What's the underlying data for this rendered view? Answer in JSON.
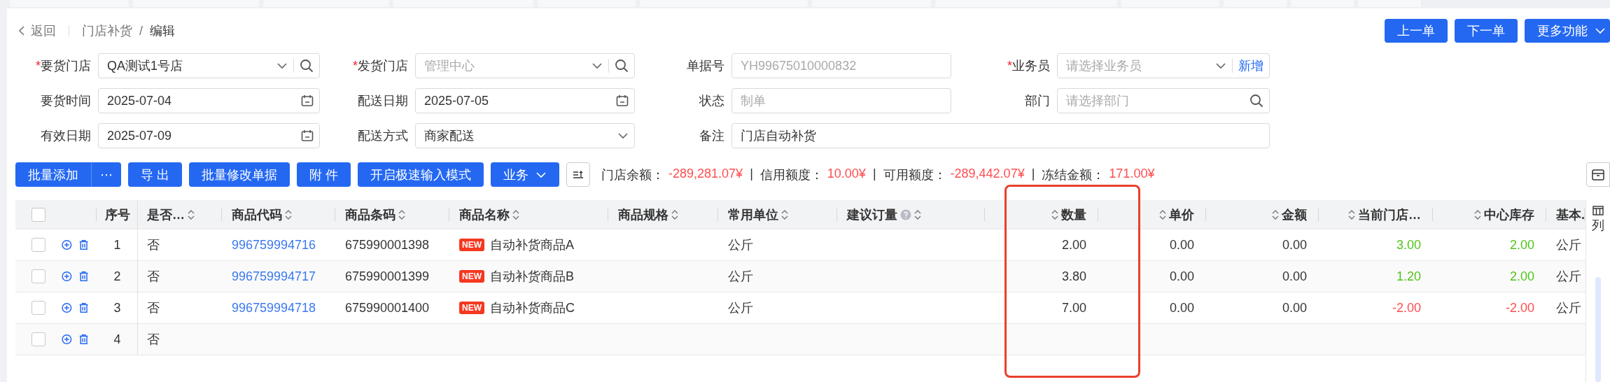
{
  "breadcrumb": {
    "back": "返回",
    "parent": "门店补货",
    "separator": "/",
    "current": "编辑"
  },
  "actions": [
    {
      "label": "上一单",
      "kind": "plain"
    },
    {
      "label": "下一单",
      "kind": "plain"
    },
    {
      "label": "更多功能",
      "kind": "dropdown"
    }
  ],
  "form": {
    "fields": [
      {
        "mark": "*",
        "label": "要货门店",
        "value": "QA测试1号店",
        "kind": "search-select"
      },
      {
        "mark": "*",
        "label": "发货门店",
        "placeholder": "管理中心",
        "kind": "search-select"
      },
      {
        "label": "单据号",
        "placeholder": "YH99675010000832",
        "kind": "text"
      },
      {
        "mark": "*",
        "label": "业务员",
        "placeholder": "请选择业务员",
        "kind": "select-add",
        "link": "新增"
      },
      {
        "label": "要货时间",
        "value": "2025-07-04",
        "kind": "date"
      },
      {
        "label": "配送日期",
        "value": "2025-07-05",
        "kind": "date"
      },
      {
        "label": "状态",
        "placeholder": "制单",
        "kind": "text"
      },
      {
        "label": "部门",
        "placeholder": "请选择部门",
        "kind": "search"
      },
      {
        "label": "有效日期",
        "value": "2025-07-09",
        "kind": "date"
      },
      {
        "label": "配送方式",
        "value": "商家配送",
        "kind": "select"
      },
      {
        "label": "备注",
        "value": "门店自动补货",
        "kind": "wide-text"
      }
    ]
  },
  "toolbar": {
    "buttons": [
      {
        "label": "批量添加",
        "kind": "split",
        "more": "⋯"
      },
      {
        "label": "导 出",
        "kind": "plain"
      },
      {
        "label": "批量修改单据",
        "kind": "plain"
      },
      {
        "label": "附 件",
        "kind": "plain"
      },
      {
        "label": "开启极速输入模式",
        "kind": "plain"
      },
      {
        "label": "业务",
        "kind": "dropdown"
      }
    ],
    "summary": [
      {
        "label": "门店余额：",
        "value": "-289,281.07¥"
      },
      {
        "separator": "|",
        "label": "信用额度：",
        "value": "10.00¥"
      },
      {
        "separator": "|",
        "label": "可用额度：",
        "value": "-289,442.07¥"
      },
      {
        "separator": "|",
        "label": "冻结金额：",
        "value": "171.00¥"
      }
    ]
  },
  "table": {
    "select_all": {
      "checked": false
    },
    "columns": [
      {
        "title": "序号",
        "kind": "index",
        "sortable": false,
        "highlighted": false
      },
      {
        "title": "是否…",
        "kind": "text",
        "sortable": true,
        "highlighted": false
      },
      {
        "title": "商品代码",
        "kind": "text",
        "sortable": true,
        "highlighted": false
      },
      {
        "title": "商品条码",
        "kind": "text",
        "sortable": true,
        "highlighted": false
      },
      {
        "title": "商品名称",
        "kind": "text",
        "sortable": true,
        "highlighted": false
      },
      {
        "title": "商品规格",
        "kind": "text",
        "sortable": true,
        "highlighted": false
      },
      {
        "title": "常用单位",
        "kind": "text",
        "sortable": true,
        "highlighted": false
      },
      {
        "title": "建议订量",
        "kind": "text",
        "sortable": true,
        "help": true,
        "highlighted": false
      },
      {
        "title": "数量",
        "kind": "number",
        "sortable": true,
        "highlighted": true
      },
      {
        "title": "单价",
        "kind": "number",
        "sortable": true,
        "highlighted": false
      },
      {
        "title": "金额",
        "kind": "number",
        "sortable": true,
        "highlighted": false
      },
      {
        "title": "当前门店…",
        "kind": "number",
        "sortable": true,
        "highlighted": false
      },
      {
        "title": "中心库存",
        "kind": "number",
        "sortable": true,
        "highlighted": false
      },
      {
        "title": "基本.",
        "kind": "text",
        "sortable": false,
        "highlighted": false
      }
    ],
    "rows": [
      {
        "checked": false,
        "cells": [
          {
            "text": "1"
          },
          {
            "text": "否"
          },
          {
            "text": "996759994716",
            "kind": "link"
          },
          {
            "text": "675990001398"
          },
          {
            "text": "自动补货商品A",
            "badge": "NEW"
          },
          null,
          {
            "text": "公斤"
          },
          null,
          {
            "text": "2.00"
          },
          {
            "text": "0.00"
          },
          {
            "text": "0.00"
          },
          {
            "text": "3.00",
            "color": "#52c41a"
          },
          {
            "text": "2.00",
            "color": "#52c41a"
          },
          {
            "text": "公斤"
          }
        ]
      },
      {
        "checked": false,
        "cells": [
          {
            "text": "2"
          },
          {
            "text": "否"
          },
          {
            "text": "996759994717",
            "kind": "link"
          },
          {
            "text": "675990001399"
          },
          {
            "text": "自动补货商品B",
            "badge": "NEW"
          },
          null,
          {
            "text": "公斤"
          },
          null,
          {
            "text": "3.80"
          },
          {
            "text": "0.00"
          },
          {
            "text": "0.00"
          },
          {
            "text": "1.20",
            "color": "#52c41a"
          },
          {
            "text": "2.00",
            "color": "#52c41a"
          },
          {
            "text": "公斤"
          }
        ]
      },
      {
        "checked": false,
        "cells": [
          {
            "text": "3"
          },
          {
            "text": "否"
          },
          {
            "text": "996759994718",
            "kind": "link"
          },
          {
            "text": "675990001400"
          },
          {
            "text": "自动补货商品C",
            "badge": "NEW"
          },
          null,
          {
            "text": "公斤"
          },
          null,
          {
            "text": "7.00"
          },
          {
            "text": "0.00"
          },
          {
            "text": "0.00"
          },
          {
            "text": "-2.00",
            "color": "#ff4d4f"
          },
          {
            "text": "-2.00",
            "color": "#ff4d4f"
          },
          {
            "text": "公斤"
          }
        ]
      },
      {
        "checked": false,
        "cells": [
          {
            "text": "4"
          },
          {
            "text": "否"
          },
          null,
          null,
          null,
          null,
          null,
          null,
          null,
          null,
          null,
          null,
          null,
          null
        ]
      }
    ],
    "column_settings": {
      "label": "列"
    }
  }
}
